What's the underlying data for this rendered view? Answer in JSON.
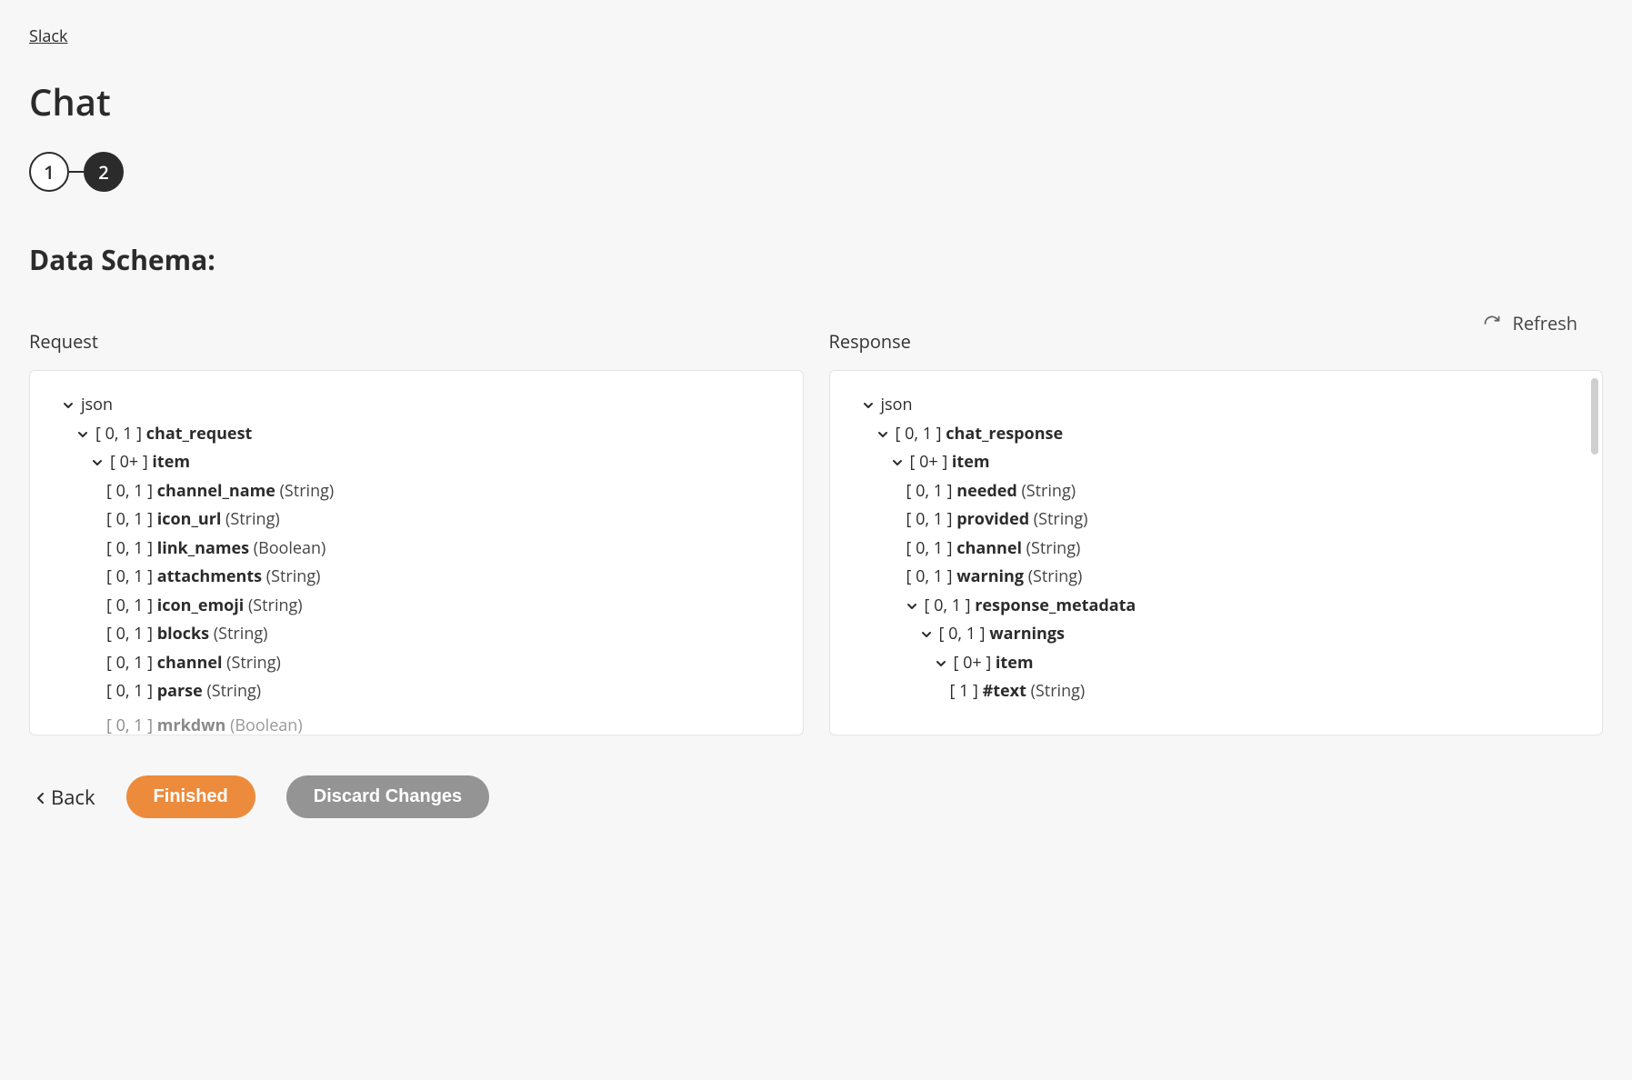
{
  "breadcrumb": "Slack",
  "page_title": "Chat",
  "stepper": {
    "step1": "1",
    "step2": "2"
  },
  "section_heading": "Data Schema:",
  "refresh_label": "Refresh",
  "columns": {
    "request": {
      "label": "Request",
      "root": "json",
      "tree": [
        {
          "indent": 1,
          "expandable": true,
          "card": "[ 0, 1 ]",
          "name": "chat_request",
          "type": ""
        },
        {
          "indent": 2,
          "expandable": true,
          "card": "[ 0+ ]",
          "name": "item",
          "type": ""
        },
        {
          "indent": 3,
          "expandable": false,
          "card": "[ 0, 1 ]",
          "name": "channel_name",
          "type": "(String)"
        },
        {
          "indent": 3,
          "expandable": false,
          "card": "[ 0, 1 ]",
          "name": "icon_url",
          "type": "(String)"
        },
        {
          "indent": 3,
          "expandable": false,
          "card": "[ 0, 1 ]",
          "name": "link_names",
          "type": "(Boolean)"
        },
        {
          "indent": 3,
          "expandable": false,
          "card": "[ 0, 1 ]",
          "name": "attachments",
          "type": "(String)"
        },
        {
          "indent": 3,
          "expandable": false,
          "card": "[ 0, 1 ]",
          "name": "icon_emoji",
          "type": "(String)"
        },
        {
          "indent": 3,
          "expandable": false,
          "card": "[ 0, 1 ]",
          "name": "blocks",
          "type": "(String)"
        },
        {
          "indent": 3,
          "expandable": false,
          "card": "[ 0, 1 ]",
          "name": "channel",
          "type": "(String)"
        },
        {
          "indent": 3,
          "expandable": false,
          "card": "[ 0, 1 ]",
          "name": "parse",
          "type": "(String)"
        },
        {
          "indent": 3,
          "expandable": false,
          "card": "[ 0, 1 ]",
          "name": "mrkdwn",
          "type": "(Boolean)",
          "cut": true
        }
      ]
    },
    "response": {
      "label": "Response",
      "root": "json",
      "tree": [
        {
          "indent": 1,
          "expandable": true,
          "card": "[ 0, 1 ]",
          "name": "chat_response",
          "type": ""
        },
        {
          "indent": 2,
          "expandable": true,
          "card": "[ 0+ ]",
          "name": "item",
          "type": ""
        },
        {
          "indent": 3,
          "expandable": false,
          "card": "[ 0, 1 ]",
          "name": "needed",
          "type": "(String)"
        },
        {
          "indent": 3,
          "expandable": false,
          "card": "[ 0, 1 ]",
          "name": "provided",
          "type": "(String)"
        },
        {
          "indent": 3,
          "expandable": false,
          "card": "[ 0, 1 ]",
          "name": "channel",
          "type": "(String)"
        },
        {
          "indent": 3,
          "expandable": false,
          "card": "[ 0, 1 ]",
          "name": "warning",
          "type": "(String)"
        },
        {
          "indent": 3,
          "expandable": true,
          "card": "[ 0, 1 ]",
          "name": "response_metadata",
          "type": ""
        },
        {
          "indent": 4,
          "expandable": true,
          "card": "[ 0, 1 ]",
          "name": "warnings",
          "type": ""
        },
        {
          "indent": 5,
          "expandable": true,
          "card": "[ 0+ ]",
          "name": "item",
          "type": ""
        },
        {
          "indent": 6,
          "expandable": false,
          "card": "[ 1 ]",
          "name": "#text",
          "type": "(String)"
        }
      ]
    }
  },
  "footer": {
    "back": "Back",
    "finished": "Finished",
    "discard": "Discard Changes"
  }
}
